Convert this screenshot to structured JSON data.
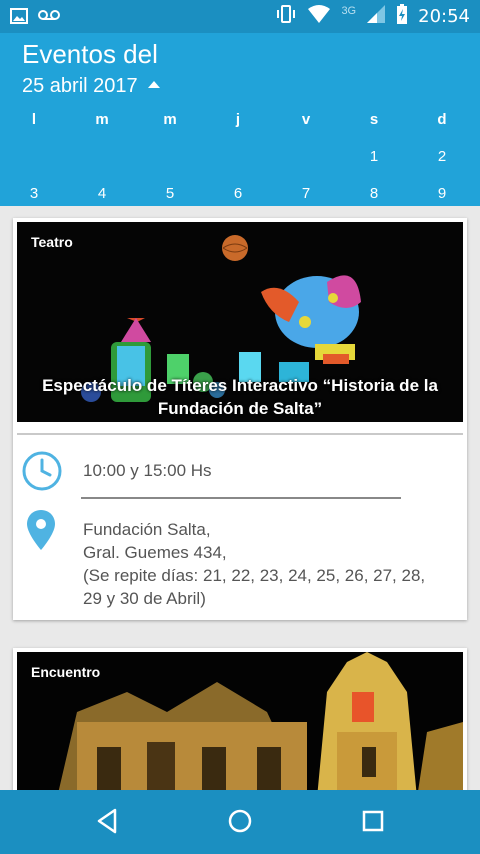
{
  "status_bar": {
    "time": "20:54",
    "network": "3G",
    "icons": [
      "image-icon",
      "voicemail-icon",
      "vibrate-icon",
      "wifi-icon",
      "signal-icon",
      "battery-icon"
    ]
  },
  "header": {
    "title": "Eventos del",
    "date": "25 abril 2017",
    "weekdays": [
      "l",
      "m",
      "m",
      "j",
      "v",
      "s",
      "d"
    ],
    "week1": [
      "",
      "",
      "",
      "",
      "",
      "1",
      "2"
    ],
    "week2": [
      "3",
      "4",
      "5",
      "6",
      "7",
      "8",
      "9"
    ]
  },
  "events": [
    {
      "category": "Teatro",
      "title_line1": "Espectáculo de Títeres Interactivo “Historia de la",
      "title_line2": "Fundación de Salta”",
      "time": "10:00 y 15:00 Hs",
      "location_lines": [
        "Fundación Salta,",
        "Gral. Guemes 434,",
        "(Se repite días: 21, 22, 23, 24, 25, 26, 27, 28,",
        "29 y 30 de Abril)"
      ]
    },
    {
      "category": "Encuentro"
    }
  ],
  "colors": {
    "status_bar": "#1b8fc1",
    "header": "#21a3d9",
    "accent": "#4fb3e2",
    "background": "#e9e9e9"
  },
  "nav": {
    "icons": [
      "back-icon",
      "home-icon",
      "recents-icon"
    ]
  }
}
